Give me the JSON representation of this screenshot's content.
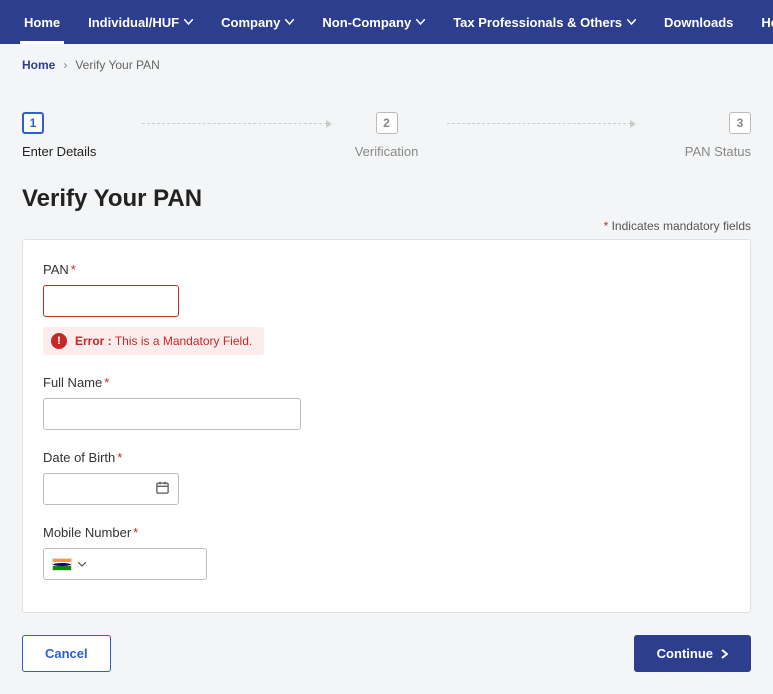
{
  "nav": {
    "items": [
      {
        "label": "Home",
        "dropdown": false,
        "active": true
      },
      {
        "label": "Individual/HUF",
        "dropdown": true,
        "active": false
      },
      {
        "label": "Company",
        "dropdown": true,
        "active": false
      },
      {
        "label": "Non-Company",
        "dropdown": true,
        "active": false
      },
      {
        "label": "Tax Professionals & Others",
        "dropdown": true,
        "active": false
      }
    ],
    "right": [
      {
        "label": "Downloads"
      },
      {
        "label": "Help"
      }
    ]
  },
  "breadcrumb": {
    "home": "Home",
    "current": "Verify Your PAN"
  },
  "stepper": {
    "steps": [
      {
        "num": "1",
        "label": "Enter Details",
        "active": true
      },
      {
        "num": "2",
        "label": "Verification",
        "active": false
      },
      {
        "num": "3",
        "label": "PAN Status",
        "active": false
      }
    ]
  },
  "heading": "Verify Your PAN",
  "mandatory_note": "Indicates mandatory fields",
  "form": {
    "pan": {
      "label": "PAN",
      "value": "",
      "error_prefix": "Error :",
      "error_msg": "This is a Mandatory Field."
    },
    "fullname": {
      "label": "Full Name",
      "value": ""
    },
    "dob": {
      "label": "Date of Birth",
      "value": ""
    },
    "mobile": {
      "label": "Mobile Number",
      "value": ""
    }
  },
  "buttons": {
    "cancel": "Cancel",
    "continue": "Continue"
  }
}
